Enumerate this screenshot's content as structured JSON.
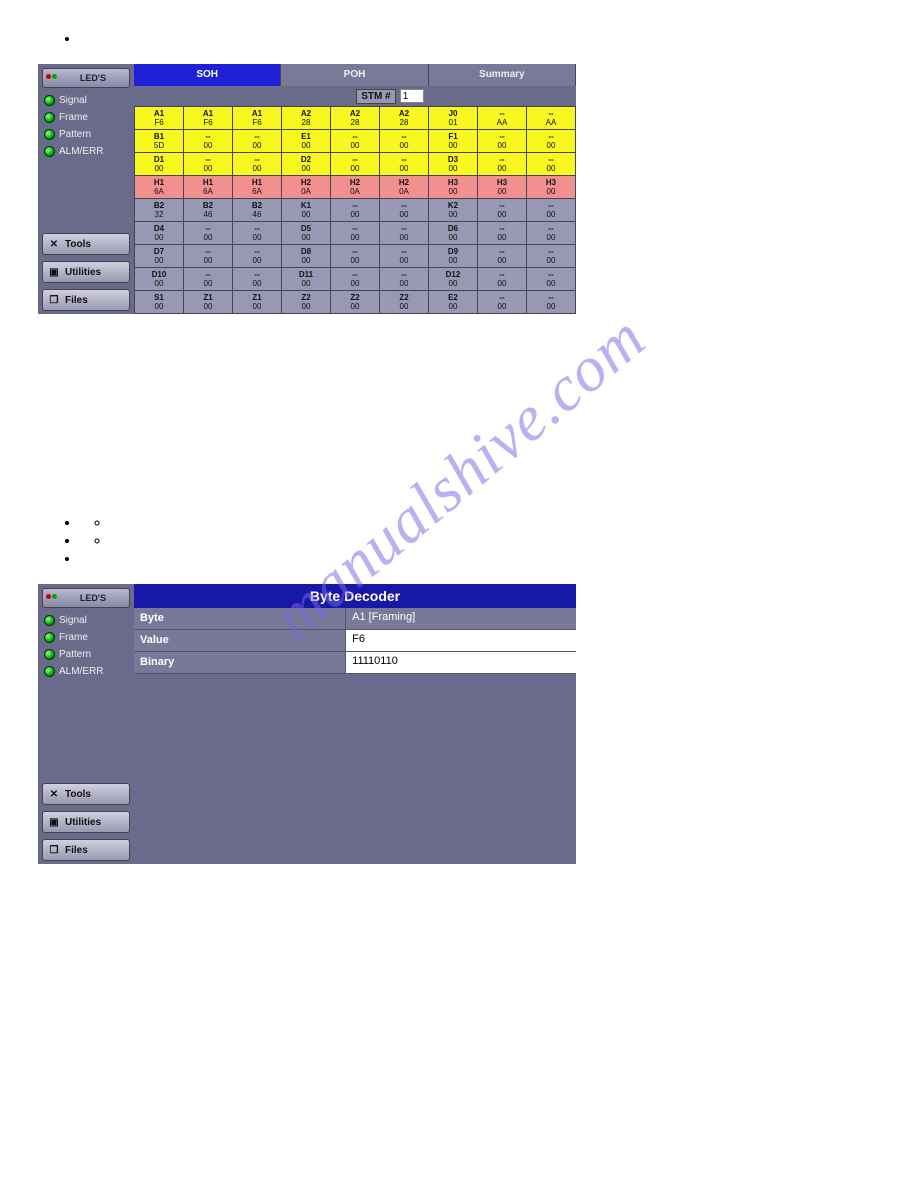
{
  "watermark": "manualshive.com",
  "sidebar": {
    "leds_label": "LED'S",
    "statuses": [
      "Signal",
      "Frame",
      "Pattern",
      "ALM/ERR"
    ],
    "buttons": [
      {
        "label": "Tools",
        "icon": "✕"
      },
      {
        "label": "Utilities",
        "icon": "▣"
      },
      {
        "label": "Files",
        "icon": "❐"
      }
    ]
  },
  "screenshot1": {
    "tabs": [
      "SOH",
      "POH",
      "Summary"
    ],
    "active_tab": 0,
    "stm_label": "STM #",
    "stm_value": "1",
    "rows": [
      {
        "cls": "yellow",
        "cells": [
          [
            "A1",
            "F6"
          ],
          [
            "A1",
            "F6"
          ],
          [
            "A1",
            "F6"
          ],
          [
            "A2",
            "28"
          ],
          [
            "A2",
            "28"
          ],
          [
            "A2",
            "28"
          ],
          [
            "J0",
            "01"
          ],
          [
            "--",
            "AA"
          ],
          [
            "--",
            "AA"
          ]
        ]
      },
      {
        "cls": "yellow",
        "cells": [
          [
            "B1",
            "5D"
          ],
          [
            "--",
            "00"
          ],
          [
            "--",
            "00"
          ],
          [
            "E1",
            "00"
          ],
          [
            "--",
            "00"
          ],
          [
            "--",
            "00"
          ],
          [
            "F1",
            "00"
          ],
          [
            "--",
            "00"
          ],
          [
            "--",
            "00"
          ]
        ]
      },
      {
        "cls": "yellow",
        "cells": [
          [
            "D1",
            "00"
          ],
          [
            "--",
            "00"
          ],
          [
            "--",
            "00"
          ],
          [
            "D2",
            "00"
          ],
          [
            "--",
            "00"
          ],
          [
            "--",
            "00"
          ],
          [
            "D3",
            "00"
          ],
          [
            "--",
            "00"
          ],
          [
            "--",
            "00"
          ]
        ]
      },
      {
        "cls": "pink",
        "cells": [
          [
            "H1",
            "6A"
          ],
          [
            "H1",
            "6A"
          ],
          [
            "H1",
            "6A"
          ],
          [
            "H2",
            "0A"
          ],
          [
            "H2",
            "0A"
          ],
          [
            "H2",
            "0A"
          ],
          [
            "H3",
            "00"
          ],
          [
            "H3",
            "00"
          ],
          [
            "H3",
            "00"
          ]
        ]
      },
      {
        "cls": "gray",
        "cells": [
          [
            "B2",
            "32"
          ],
          [
            "B2",
            "46"
          ],
          [
            "B2",
            "46"
          ],
          [
            "K1",
            "00"
          ],
          [
            "--",
            "00"
          ],
          [
            "--",
            "00"
          ],
          [
            "K2",
            "00"
          ],
          [
            "--",
            "00"
          ],
          [
            "--",
            "00"
          ]
        ]
      },
      {
        "cls": "gray",
        "cells": [
          [
            "D4",
            "00"
          ],
          [
            "--",
            "00"
          ],
          [
            "--",
            "00"
          ],
          [
            "D5",
            "00"
          ],
          [
            "--",
            "00"
          ],
          [
            "--",
            "00"
          ],
          [
            "D6",
            "00"
          ],
          [
            "--",
            "00"
          ],
          [
            "--",
            "00"
          ]
        ]
      },
      {
        "cls": "gray",
        "cells": [
          [
            "D7",
            "00"
          ],
          [
            "--",
            "00"
          ],
          [
            "--",
            "00"
          ],
          [
            "D8",
            "00"
          ],
          [
            "--",
            "00"
          ],
          [
            "--",
            "00"
          ],
          [
            "D9",
            "00"
          ],
          [
            "--",
            "00"
          ],
          [
            "--",
            "00"
          ]
        ]
      },
      {
        "cls": "gray",
        "cells": [
          [
            "D10",
            "00"
          ],
          [
            "--",
            "00"
          ],
          [
            "--",
            "00"
          ],
          [
            "D11",
            "00"
          ],
          [
            "--",
            "00"
          ],
          [
            "--",
            "00"
          ],
          [
            "D12",
            "00"
          ],
          [
            "--",
            "00"
          ],
          [
            "--",
            "00"
          ]
        ]
      },
      {
        "cls": "gray",
        "cells": [
          [
            "S1",
            "00"
          ],
          [
            "Z1",
            "00"
          ],
          [
            "Z1",
            "00"
          ],
          [
            "Z2",
            "00"
          ],
          [
            "Z2",
            "00"
          ],
          [
            "Z2",
            "00"
          ],
          [
            "E2",
            "00"
          ],
          [
            "--",
            "00"
          ],
          [
            "--",
            "00"
          ]
        ]
      }
    ]
  },
  "screenshot2": {
    "title": "Byte Decoder",
    "rows": [
      {
        "k": "Byte",
        "v": "A1 [Framing]",
        "plain": true
      },
      {
        "k": "Value",
        "v": "F6",
        "plain": false
      },
      {
        "k": "Binary",
        "v": "11110110",
        "plain": false
      }
    ]
  }
}
